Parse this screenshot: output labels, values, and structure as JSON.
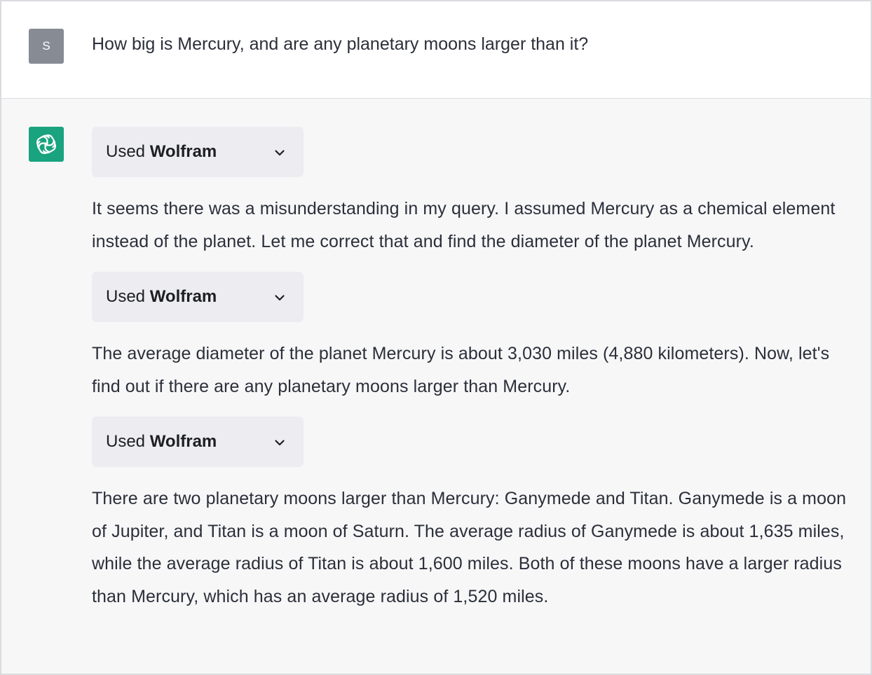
{
  "user_message": {
    "avatar_initial": "S",
    "text": "How big is Mercury, and are any planetary moons larger than it?"
  },
  "assistant_message": {
    "avatar_icon": "openai-logo-icon",
    "tool_calls": [
      {
        "prefix": "Used ",
        "name": "Wolfram",
        "icon": "chevron-down-icon"
      },
      {
        "prefix": "Used ",
        "name": "Wolfram",
        "icon": "chevron-down-icon"
      },
      {
        "prefix": "Used ",
        "name": "Wolfram",
        "icon": "chevron-down-icon"
      }
    ],
    "paragraphs": [
      "It seems there was a misunderstanding in my query. I assumed Mercury as a chemical element instead of the planet. Let me correct that and find the diameter of the planet Mercury.",
      "The average diameter of the planet Mercury is about 3,030 miles (4,880 kilometers). Now, let's find out if there are any planetary moons larger than Mercury.",
      "There are two planetary moons larger than Mercury: Ganymede and Titan. Ganymede is a moon of Jupiter, and Titan is a moon of Saturn. The average radius of Ganymede is about 1,635 miles, while the average radius of Titan is about 1,600 miles. Both of these moons have a larger radius than Mercury, which has an average radius of 1,520 miles."
    ]
  },
  "colors": {
    "user_bg": "#ffffff",
    "assistant_bg": "#f7f7f8",
    "user_avatar_bg": "#878b94",
    "bot_avatar_bg": "#19a37f",
    "tool_pill_bg": "#ececf1",
    "text": "#2b2f3a"
  }
}
